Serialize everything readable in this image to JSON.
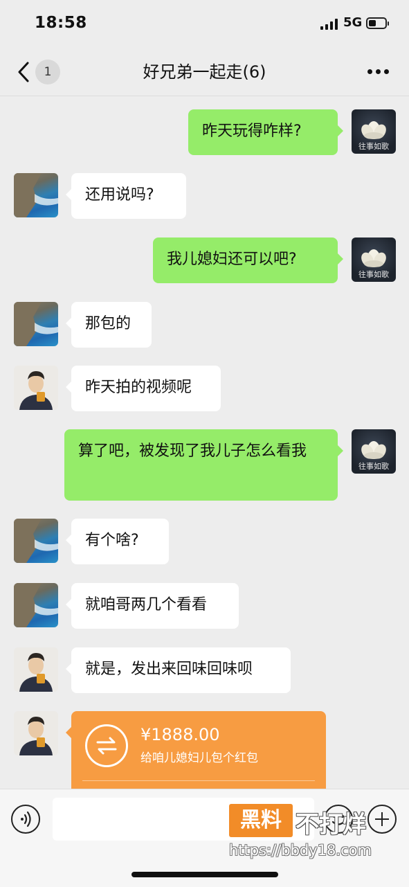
{
  "status_bar": {
    "time": "18:58",
    "network": "5G"
  },
  "header": {
    "title": "好兄弟一起走(6)",
    "unread_count": "1"
  },
  "avatar_caption": "往事如歌",
  "messages": [
    {
      "side": "out",
      "avatar": "lotus-avatar",
      "text": "昨天玩得咋样?"
    },
    {
      "side": "in",
      "avatar": "sea-cliff-avatar",
      "text": "还用说吗?"
    },
    {
      "side": "out",
      "avatar": "lotus-avatar",
      "text": "我儿媳妇还可以吧?"
    },
    {
      "side": "in",
      "avatar": "sea-cliff-avatar",
      "text": "那包的"
    },
    {
      "side": "in",
      "avatar": "man-with-beer-avatar",
      "text": "昨天拍的视频呢"
    },
    {
      "side": "out",
      "avatar": "lotus-avatar",
      "text": "算了吧，被发现了我儿子怎么看我"
    },
    {
      "side": "in",
      "avatar": "sea-cliff-avatar",
      "text": "有个啥?"
    },
    {
      "side": "in",
      "avatar": "sea-cliff-avatar",
      "text": "就咱哥两几个看看"
    },
    {
      "side": "in",
      "avatar": "man-with-beer-avatar",
      "text": "就是，发出来回味回味呗"
    }
  ],
  "transfer": {
    "amount": "¥1888.00",
    "note": "给咱儿媳妇儿包个红包",
    "color": "#f79c42"
  },
  "watermark": {
    "badge": "黑料",
    "text": "不打烊",
    "url": "https://bbdy18.com"
  },
  "colors": {
    "outgoing_bubble": "#95ec69",
    "incoming_bubble": "#ffffff",
    "background": "#ededed"
  }
}
